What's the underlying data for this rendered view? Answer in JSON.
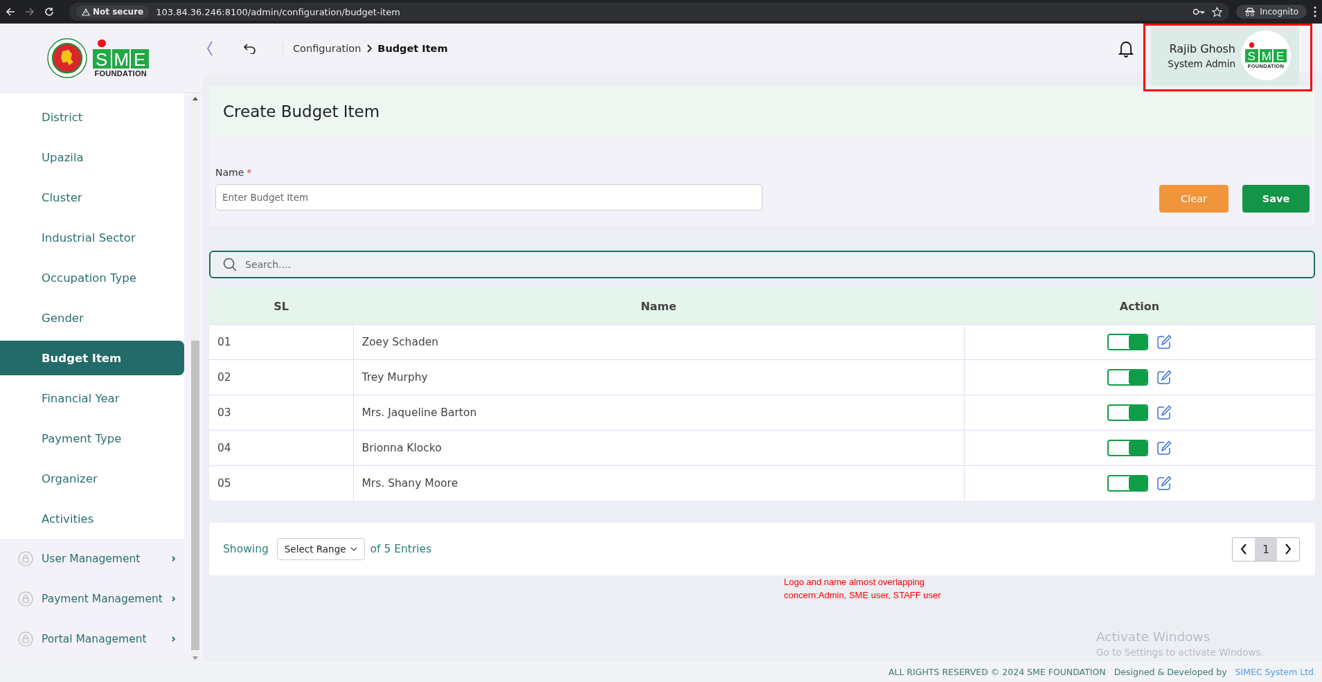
{
  "browser": {
    "security": "Not secure",
    "url": "103.84.36.246:8100/admin/configuration/budget-item",
    "profile": "Incognito"
  },
  "logo": {
    "letters": [
      "S",
      "M",
      "E"
    ],
    "caption": "FOUNDATION"
  },
  "breadcrumb": [
    {
      "label": "Configuration"
    },
    {
      "label": "Budget Item"
    }
  ],
  "user": {
    "name": "Rajib Ghosh",
    "role": "System Admin",
    "flagged": true,
    "logo": {
      "letters": [
        "S",
        "M",
        "E"
      ],
      "caption": "FOUNDATION"
    }
  },
  "sidebar": {
    "items": [
      {
        "label": "District",
        "selected": false
      },
      {
        "label": "Upazila",
        "selected": false
      },
      {
        "label": "Cluster",
        "selected": false
      },
      {
        "label": "Industrial Sector",
        "selected": false
      },
      {
        "label": "Occupation Type",
        "selected": false
      },
      {
        "label": "Gender",
        "selected": false
      },
      {
        "label": "Budget Item",
        "selected": true
      },
      {
        "label": "Financial Year",
        "selected": false
      },
      {
        "label": "Payment Type",
        "selected": false
      },
      {
        "label": "Organizer",
        "selected": false
      },
      {
        "label": "Activities",
        "selected": false
      }
    ],
    "groups": [
      {
        "label": "User Management"
      },
      {
        "label": "Payment Management"
      },
      {
        "label": "Portal Management"
      }
    ]
  },
  "form": {
    "title": "Create Budget Item",
    "field_label": "Name",
    "required_mark": "*",
    "placeholder": "Enter Budget Item",
    "buttons": [
      {
        "label": "Clear",
        "kind": "clear"
      },
      {
        "label": "Save",
        "kind": "save"
      }
    ]
  },
  "search": {
    "placeholder": "Search...."
  },
  "table": {
    "columns": [
      "SL",
      "Name",
      "Action"
    ],
    "rows": [
      {
        "sl": "01",
        "name": "Zoey Schaden",
        "active": true
      },
      {
        "sl": "02",
        "name": "Trey Murphy",
        "active": true
      },
      {
        "sl": "03",
        "name": "Mrs. Jaqueline Barton",
        "active": true
      },
      {
        "sl": "04",
        "name": "Brionna Klocko",
        "active": true
      },
      {
        "sl": "05",
        "name": "Mrs. Shany Moore",
        "active": true
      }
    ]
  },
  "pager": {
    "showing": "Showing",
    "range": "Select Range",
    "total": "of 5 Entries",
    "pages": [
      {
        "label": "1",
        "selected": true
      }
    ]
  },
  "annotation": [
    "Logo and name almost overlapping",
    "concern:Admin, SME user, STAFF user"
  ],
  "os_notice": {
    "title": "Activate Windows",
    "subtitle": "Go to Settings to activate Windows."
  },
  "footer": {
    "copyright": "ALL RIGHTS RESERVED © 2024 SME FOUNDATION",
    "credit": "Designed & Developed by",
    "credit_link": "SIMEC System Ltd"
  }
}
